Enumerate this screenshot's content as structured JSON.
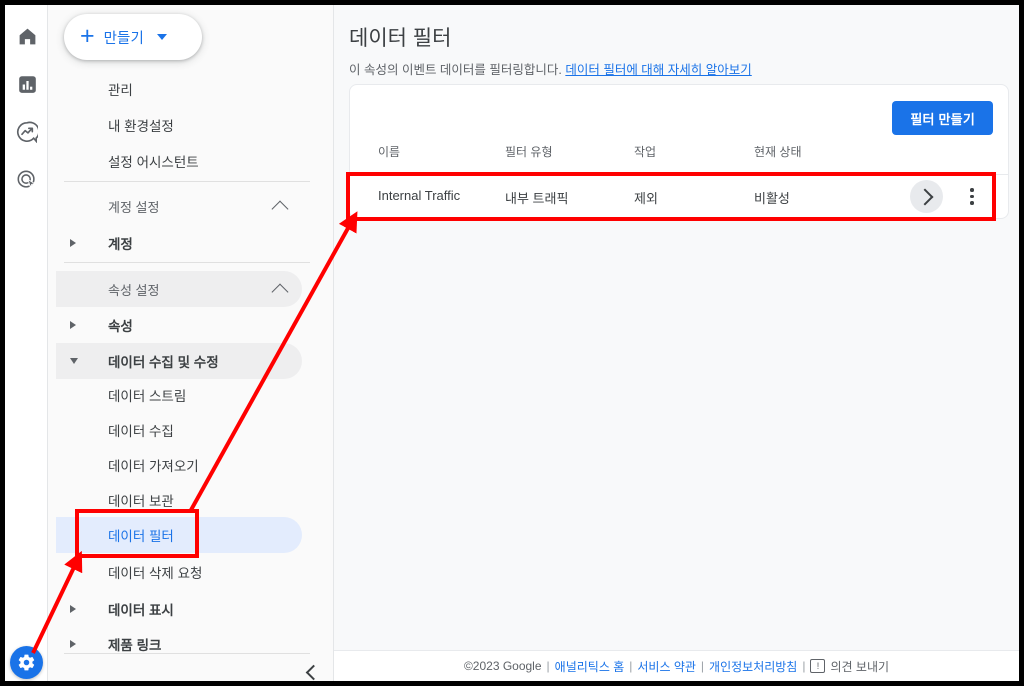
{
  "rail": {
    "items": [
      {
        "name": "home-icon",
        "label": "홈"
      },
      {
        "name": "reports-icon",
        "label": "보고서"
      },
      {
        "name": "explore-icon",
        "label": "탐색"
      },
      {
        "name": "advertising-icon",
        "label": "광고"
      }
    ],
    "settings_icon": "gear-icon"
  },
  "sidebar": {
    "create_button": {
      "label": "만들기",
      "plus": "+",
      "caret": "▾"
    },
    "items": [
      {
        "label": "관리",
        "type": "plain"
      },
      {
        "label": "내 환경설정",
        "type": "plain"
      },
      {
        "label": "설정 어시스턴트",
        "type": "plain"
      },
      {
        "label": "계정 설정",
        "type": "section"
      },
      {
        "label": "계정",
        "type": "group"
      },
      {
        "label": "속성 설정",
        "type": "section"
      },
      {
        "label": "속성",
        "type": "group"
      },
      {
        "label": "데이터 수집 및 수정",
        "type": "group"
      },
      {
        "label": "데이터 스트림",
        "type": "child"
      },
      {
        "label": "데이터 수집",
        "type": "child"
      },
      {
        "label": "데이터 가져오기",
        "type": "child"
      },
      {
        "label": "데이터 보관",
        "type": "child"
      },
      {
        "label": "데이터 필터",
        "type": "child"
      },
      {
        "label": "데이터 삭제 요청",
        "type": "child"
      },
      {
        "label": "데이터 표시",
        "type": "group"
      },
      {
        "label": "제품 링크",
        "type": "group"
      }
    ],
    "active_item": "데이터 필터",
    "collapse_icon": "chevron-left-icon"
  },
  "main": {
    "title": "데이터 필터",
    "subtitle_text": "이 속성의 이벤트 데이터를 필터링합니다.",
    "subtitle_link": "데이터 필터에 대해 자세히 알아보기",
    "create_filter_label": "필터 만들기",
    "table": {
      "columns": [
        "이름",
        "필터 유형",
        "작업",
        "현재 상태"
      ],
      "rows": [
        {
          "name": "Internal Traffic",
          "filter_type": "내부 트래픽",
          "operation": "제외",
          "state": "비활성"
        }
      ],
      "row_chevron_icon": "chevron-right-icon",
      "row_menu_icon": "more-vert-icon"
    }
  },
  "footer": {
    "copyright": "©2023 Google",
    "links": [
      "애널리틱스 홈",
      "서비스 약관",
      "개인정보처리방침"
    ],
    "feedback_label": "의견 보내기",
    "feedback_icon": "feedback-icon",
    "separator": "|"
  },
  "annotations": {
    "highlight_color": "#ff0000",
    "boxes": [
      "sidebar-data-filter",
      "table-row-internal-traffic"
    ],
    "arrows": [
      "gear-to-data-filter",
      "data-filter-to-table-row"
    ]
  },
  "colors": {
    "accent": "#1a73e8",
    "active_bg": "#e3ecfd",
    "page_bg": "#f8f9fa",
    "annotation": "#ff0000"
  }
}
